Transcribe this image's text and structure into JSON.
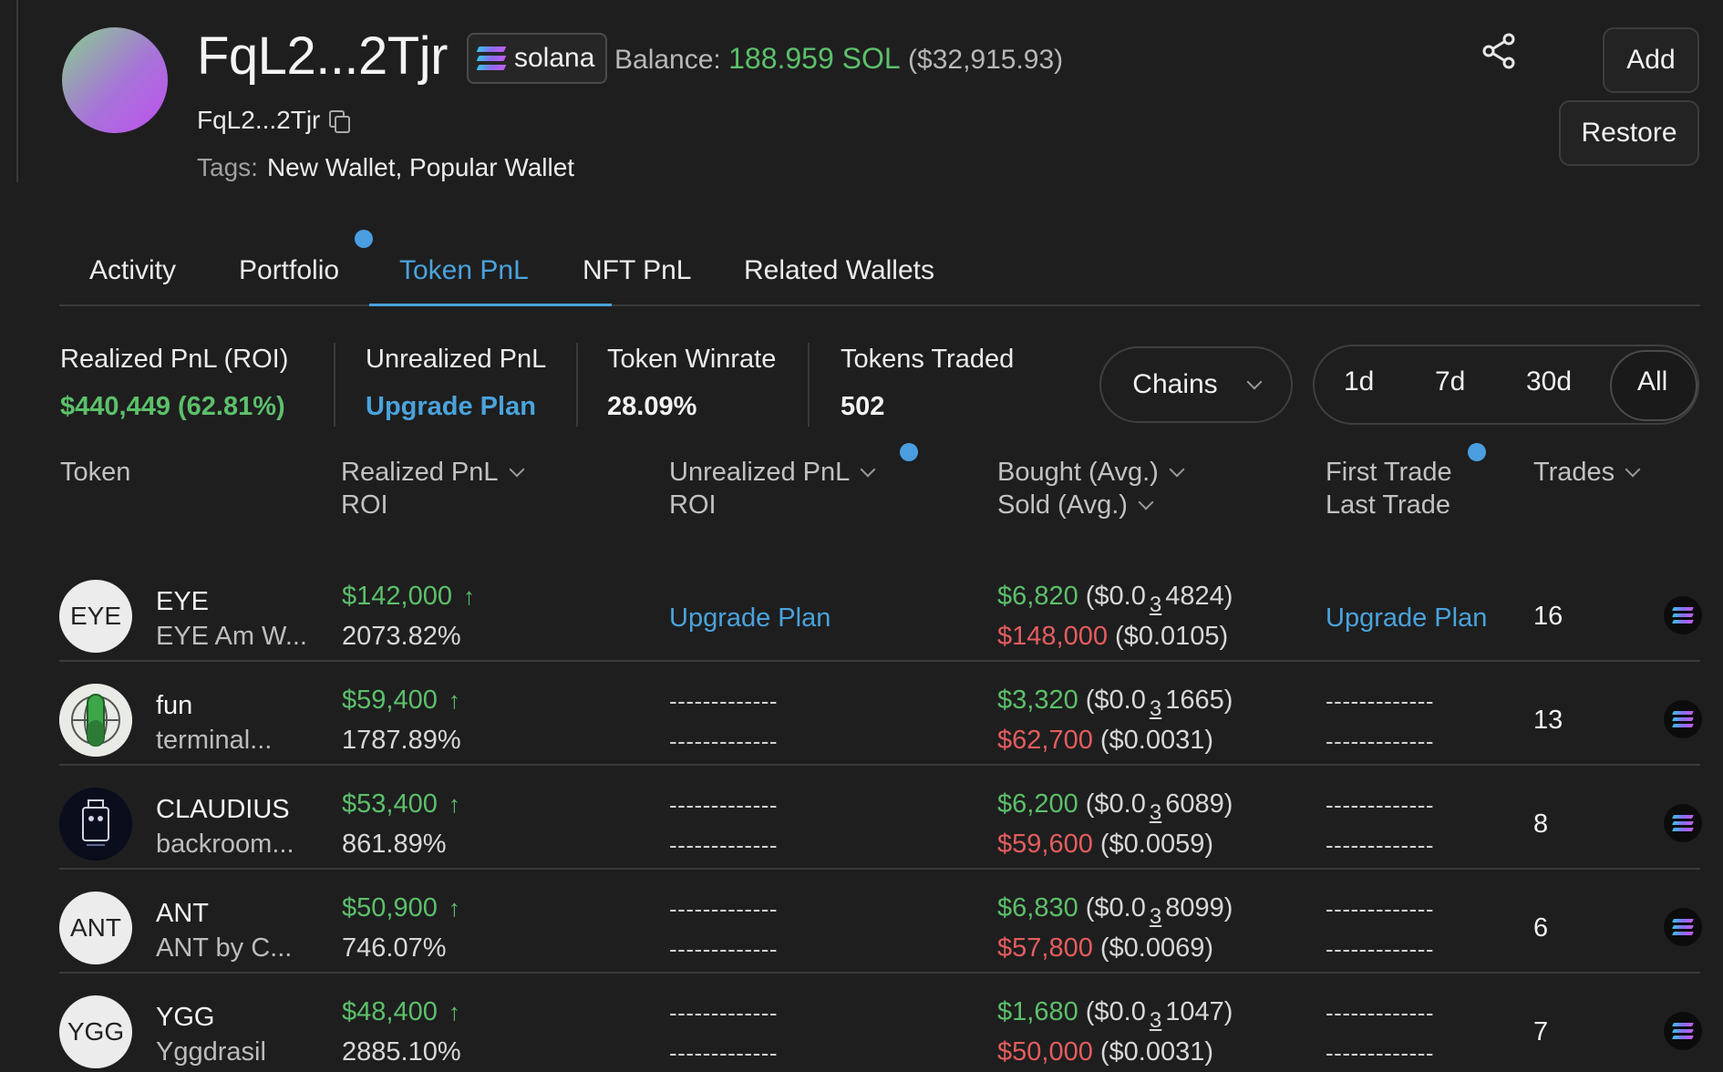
{
  "header": {
    "title": "FqL2...2Tjr",
    "chain": "solana",
    "balance_label": "Balance:",
    "balance_sol": "188.959 SOL",
    "balance_usd": "($32,915.93)",
    "address": "FqL2...2Tjr",
    "tags_label": "Tags:",
    "tags_value": "New Wallet, Popular Wallet",
    "add_label": "Add",
    "restore_label": "Restore"
  },
  "tabs": [
    {
      "label": "Activity"
    },
    {
      "label": "Portfolio"
    },
    {
      "label": "Token PnL",
      "active": true
    },
    {
      "label": "NFT PnL"
    },
    {
      "label": "Related Wallets"
    }
  ],
  "stats": {
    "realized_label": "Realized PnL (ROI)",
    "realized_value": "$440,449 (62.81%)",
    "unrealized_label": "Unrealized PnL",
    "unrealized_value": "Upgrade Plan",
    "winrate_label": "Token Winrate",
    "winrate_value": "28.09%",
    "traded_label": "Tokens Traded",
    "traded_value": "502"
  },
  "filters": {
    "chains_label": "Chains",
    "ranges": [
      "1d",
      "7d",
      "30d",
      "All"
    ],
    "active_range": "All"
  },
  "table": {
    "headers": {
      "token": "Token",
      "realized": "Realized PnL",
      "realized_sub": "ROI",
      "unrealized": "Unrealized PnL",
      "unrealized_sub": "ROI",
      "bought": "Bought (Avg.)",
      "sold": "Sold (Avg.)",
      "first_trade": "First Trade",
      "last_trade": "Last Trade",
      "trades": "Trades"
    },
    "rows": [
      {
        "logo": "EYE",
        "symbol": "EYE",
        "name": "EYE Am W...",
        "pnl": "$142,000",
        "roi": "2073.82%",
        "unrealized": "Upgrade Plan",
        "bought": "$6,820",
        "bought_pre": "($0.0",
        "bought_sub": "3",
        "bought_post": "4824)",
        "sold": "$148,000",
        "sold_avg": "($0.0105)",
        "trade_dates": "Upgrade Plan",
        "trades": "16"
      },
      {
        "logo": "",
        "symbol": "fun",
        "name": "terminal...",
        "pnl": "$59,400",
        "roi": "1787.89%",
        "dash": "-------------",
        "bought": "$3,320",
        "bought_pre": "($0.0",
        "bought_sub": "3",
        "bought_post": "1665)",
        "sold": "$62,700",
        "sold_avg": "($0.0031)",
        "trades": "13"
      },
      {
        "logo": "",
        "symbol": "CLAUDIUS",
        "name": "backroom...",
        "pnl": "$53,400",
        "roi": "861.89%",
        "dash": "-------------",
        "bought": "$6,200",
        "bought_pre": "($0.0",
        "bought_sub": "3",
        "bought_post": "6089)",
        "sold": "$59,600",
        "sold_avg": "($0.0059)",
        "trades": "8"
      },
      {
        "logo": "ANT",
        "symbol": "ANT",
        "name": "ANT by C...",
        "pnl": "$50,900",
        "roi": "746.07%",
        "dash": "-------------",
        "bought": "$6,830",
        "bought_pre": "($0.0",
        "bought_sub": "3",
        "bought_post": "8099)",
        "sold": "$57,800",
        "sold_avg": "($0.0069)",
        "trades": "6"
      },
      {
        "logo": "YGG",
        "symbol": "YGG",
        "name": "Yggdrasil",
        "pnl": "$48,400",
        "roi": "2885.10%",
        "dash": "-------------",
        "bought": "$1,680",
        "bought_pre": "($0.0",
        "bought_sub": "3",
        "bought_post": "1047)",
        "sold": "$50,000",
        "sold_avg": "($0.0031)",
        "trades": "7"
      }
    ]
  },
  "icons": {
    "share": "share-icon",
    "copy": "copy-icon",
    "chain": "solana-icon",
    "arrow": "arrow-up-icon"
  },
  "colors": {
    "green": "#5cc06a",
    "red": "#e55d5d",
    "accent": "#4aa3dc",
    "background": "#1e1e1f"
  }
}
